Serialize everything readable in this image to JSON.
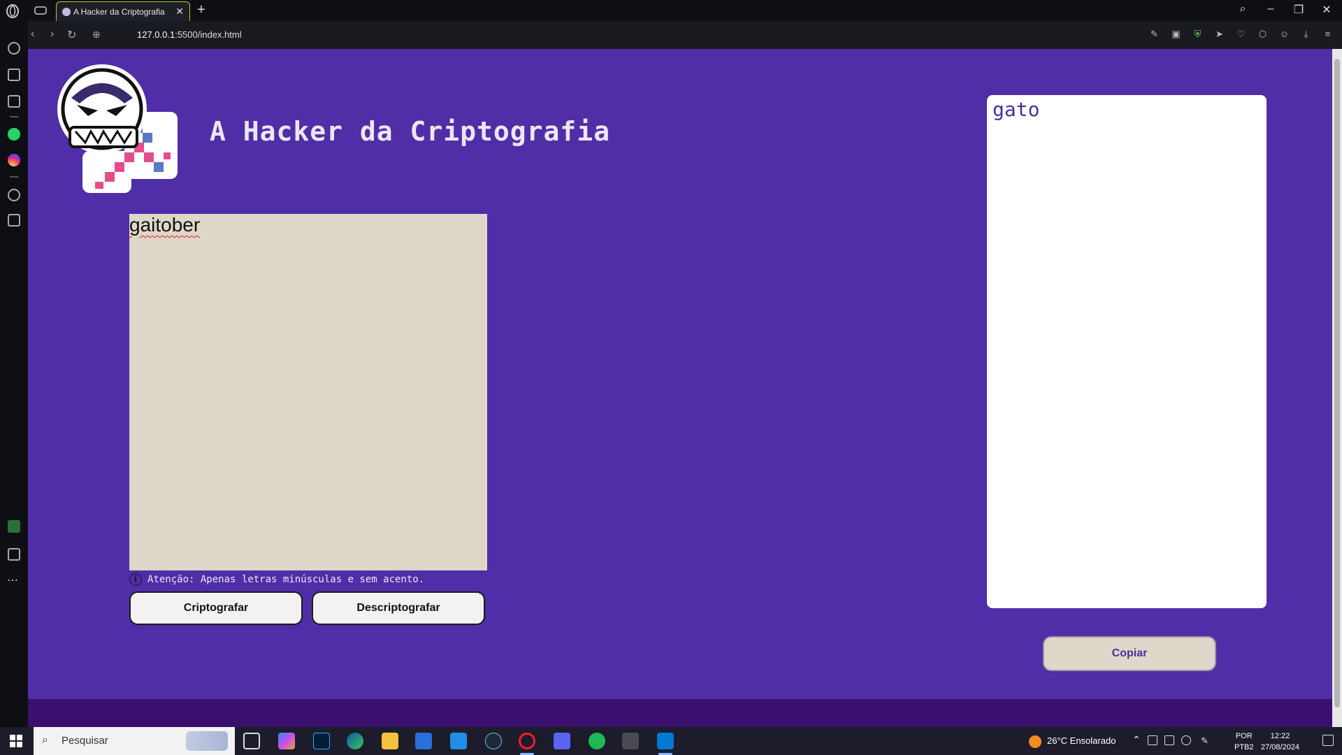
{
  "browser": {
    "tab_title": "A Hacker da Criptografia",
    "url_host": "127.0.0.1",
    "url_path": ":5500/index.html"
  },
  "page": {
    "title": "A Hacker da Criptografia",
    "input_value": "gaitober",
    "warning": "Atenção: Apenas letras minúsculas e sem acento.",
    "encrypt_label": "Criptografar",
    "decrypt_label": "Descriptografar",
    "output_value": "gato",
    "copy_label": "Copiar",
    "colors": {
      "background": "#4f2ea8",
      "input_bg": "#dfd7c9",
      "accent_text": "#4b2ea0",
      "footer": "#3a0f6e"
    }
  },
  "taskbar": {
    "search_placeholder": "Pesquisar",
    "weather": "26°C  Ensolarado",
    "lang_1": "POR",
    "lang_2": "PTB2",
    "time": "12:22",
    "date": "27/08/2024"
  }
}
